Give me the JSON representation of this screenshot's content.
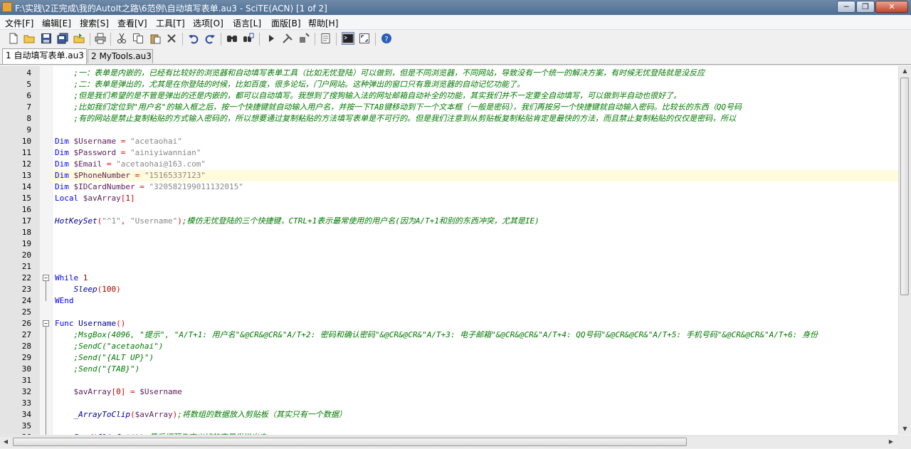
{
  "window": {
    "title": "F:\\实践\\2正完成\\我的AutoIt之路\\6范例\\自动填写表单.au3 - SciTE(ACN) [1 of 2]",
    "minimize": "─",
    "maximize": "❐",
    "close": "✕"
  },
  "menu": [
    "文件[F]",
    "编辑[E]",
    "搜索[S]",
    "查看[V]",
    "工具[T]",
    "选项[O]",
    "语言[L]",
    "面版[B]",
    "帮助[H]"
  ],
  "tabs": [
    "1 自动填写表单.au3",
    "2 MyTools.au3"
  ],
  "toolbar_icons": [
    "new-file-icon",
    "open-folder-icon",
    "save-icon",
    "save-all-icon",
    "open-recent-icon",
    "print-icon",
    "cut-icon",
    "copy-icon",
    "paste-icon",
    "delete-icon",
    "undo-icon",
    "redo-icon",
    "find-icon",
    "replace-icon",
    "run-icon",
    "build-icon",
    "compile-icon",
    "properties-icon",
    "console-icon",
    "fullscreen-icon",
    "help-icon"
  ],
  "colors": {
    "current_line": "#fffbdc",
    "comment": "#007a00",
    "keyword": "#0000ff",
    "string": "#888888"
  },
  "lines": [
    {
      "n": "4",
      "t": [
        {
          "c": "cm",
          "s": "    ;一：表单是内嵌的，已经有比较好的浏览器和自动填写表单工具（比如无忧登陆）可以做到，但是不同浏览器，不同网站，导致没有一个统一的解决方案，有时候无忧登陆就是没反应"
        }
      ]
    },
    {
      "n": "5",
      "t": [
        {
          "c": "cm",
          "s": "    ;二：表单是弹出的，尤其是在你登陆的时候，比如百度，很多论坛，门户网站。这种弹出的窗口只有靠浏览器的自动记忆功能了。"
        }
      ]
    },
    {
      "n": "6",
      "t": [
        {
          "c": "cm",
          "s": "    ;但是我们希望的是不管是弹出的还是内嵌的，都可以自动填写。我想到了搜狗输入法的网址邮箱自动补全的功能，其实我们并不一定要全自动填写，可以做到半自动也很好了。"
        }
      ]
    },
    {
      "n": "7",
      "t": [
        {
          "c": "cm",
          "s": "    ;比如我们定位到\"用户名\"的输入框之后，按一个快捷键就自动输入用户名，并按一下TAB键移动到下一个文本框（一般是密码），我们再按另一个快捷键就自动输入密码。比较长的东西（QQ号码"
        }
      ]
    },
    {
      "n": "8",
      "t": [
        {
          "c": "cm",
          "s": "    ;有的网站是禁止复制粘贴的方式输入密码的，所以想要通过复制粘贴的方法填写表单是不可行的。但是我们注意到从剪贴板复制粘贴肯定是最快的方法，而且禁止复制粘贴的仅仅是密码，所以"
        }
      ]
    },
    {
      "n": "9",
      "t": []
    },
    {
      "n": "10",
      "t": [
        {
          "c": "kw",
          "s": "Dim "
        },
        {
          "c": "vr",
          "s": "$Username"
        },
        {
          "c": "op",
          "s": " = "
        },
        {
          "c": "st",
          "s": "\"acetaohai\""
        }
      ]
    },
    {
      "n": "11",
      "t": [
        {
          "c": "kw",
          "s": "Dim "
        },
        {
          "c": "vr",
          "s": "$Password"
        },
        {
          "c": "op",
          "s": " = "
        },
        {
          "c": "st",
          "s": "\"ainiyiwannian\""
        }
      ]
    },
    {
      "n": "12",
      "t": [
        {
          "c": "kw",
          "s": "Dim "
        },
        {
          "c": "vr",
          "s": "$Email"
        },
        {
          "c": "op",
          "s": " = "
        },
        {
          "c": "st",
          "s": "\"acetaohai@163.com\""
        }
      ]
    },
    {
      "n": "13",
      "t": [
        {
          "c": "kw",
          "s": "Dim "
        },
        {
          "c": "vr",
          "s": "$PhoneNumber"
        },
        {
          "c": "op",
          "s": " = "
        },
        {
          "c": "st",
          "s": "\"15165337123\""
        }
      ]
    },
    {
      "n": "14",
      "t": [
        {
          "c": "kw",
          "s": "Dim "
        },
        {
          "c": "vr",
          "s": "$IDCardNumber"
        },
        {
          "c": "op",
          "s": " = "
        },
        {
          "c": "st",
          "s": "\"320582199011132015\""
        }
      ]
    },
    {
      "n": "15",
      "t": [
        {
          "c": "kw",
          "s": "Local "
        },
        {
          "c": "vr",
          "s": "$avArray"
        },
        {
          "c": "op",
          "s": "["
        },
        {
          "c": "nm",
          "s": "1"
        },
        {
          "c": "op",
          "s": "]"
        }
      ]
    },
    {
      "n": "16",
      "t": []
    },
    {
      "n": "17",
      "t": [
        {
          "c": "fn",
          "s": "HotKeySet"
        },
        {
          "c": "op",
          "s": "("
        },
        {
          "c": "st",
          "s": "\"^1\""
        },
        {
          "c": "op",
          "s": ", "
        },
        {
          "c": "st",
          "s": "\"Username\""
        },
        {
          "c": "op",
          "s": ")"
        },
        {
          "c": "cm",
          "s": ";模仿无忧登陆的三个快捷键，CTRL+1表示最常使用的用户名(因为A/T+1和别的东西冲突，尤其是IE)"
        }
      ]
    },
    {
      "n": "18",
      "t": []
    },
    {
      "n": "19",
      "t": []
    },
    {
      "n": "20",
      "t": []
    },
    {
      "n": "21",
      "t": []
    },
    {
      "n": "22",
      "t": [
        {
          "c": "kw",
          "s": "While "
        },
        {
          "c": "nm",
          "s": "1"
        }
      ]
    },
    {
      "n": "23",
      "t": [
        {
          "c": "",
          "s": "    "
        },
        {
          "c": "fn",
          "s": "Sleep"
        },
        {
          "c": "op",
          "s": "("
        },
        {
          "c": "nm",
          "s": "100"
        },
        {
          "c": "op",
          "s": ")"
        }
      ]
    },
    {
      "n": "24",
      "t": [
        {
          "c": "kw",
          "s": "WEnd"
        }
      ]
    },
    {
      "n": "25",
      "t": []
    },
    {
      "n": "26",
      "t": [
        {
          "c": "kw",
          "s": "Func "
        },
        {
          "c": "fnu",
          "s": "Username"
        },
        {
          "c": "op",
          "s": "()"
        }
      ]
    },
    {
      "n": "27",
      "t": [
        {
          "c": "cm",
          "s": "    ;MsgBox(4096, \"提示\", \"A/T+1: 用户名\"&@CR&@CR&\"A/T+2: 密码和确认密码\"&@CR&@CR&\"A/T+3: 电子邮箱\"&@CR&@CR&\"A/T+4: QQ号码\"&@CR&@CR&\"A/T+5: 手机号码\"&@CR&@CR&\"A/T+6: 身份"
        }
      ]
    },
    {
      "n": "28",
      "t": [
        {
          "c": "cm",
          "s": "    ;SendC(\"acetaohai\")"
        }
      ]
    },
    {
      "n": "29",
      "t": [
        {
          "c": "cm",
          "s": "    ;Send(\"{ALT UP}\")"
        }
      ]
    },
    {
      "n": "30",
      "t": [
        {
          "c": "cm",
          "s": "    ;Send(\"{TAB}\")"
        }
      ]
    },
    {
      "n": "31",
      "t": []
    },
    {
      "n": "32",
      "t": [
        {
          "c": "",
          "s": "    "
        },
        {
          "c": "vr",
          "s": "$avArray"
        },
        {
          "c": "op",
          "s": "["
        },
        {
          "c": "nm",
          "s": "0"
        },
        {
          "c": "op",
          "s": "] = "
        },
        {
          "c": "vr",
          "s": "$Username"
        }
      ]
    },
    {
      "n": "33",
      "t": []
    },
    {
      "n": "34",
      "t": [
        {
          "c": "",
          "s": "    "
        },
        {
          "c": "fn",
          "s": "_ArrayToClip"
        },
        {
          "c": "op",
          "s": "("
        },
        {
          "c": "vr",
          "s": "$avArray"
        },
        {
          "c": "op",
          "s": ")"
        },
        {
          "c": "cm",
          "s": ";将数组的数据放入剪贴板（其实只有一个数据）"
        }
      ]
    },
    {
      "n": "35",
      "t": []
    },
    {
      "n": "36",
      "t": [
        {
          "c": "",
          "s": "    "
        },
        {
          "c": "fn",
          "s": "Send"
        },
        {
          "c": "op",
          "s": "("
        },
        {
          "c": "fn",
          "s": "ClipGet"
        },
        {
          "c": "op",
          "s": "())"
        },
        {
          "c": "cm",
          "s": ";最后把预先定义好的变量发送出去"
        }
      ]
    }
  ],
  "current_line": "13",
  "fold_lines": [
    "22",
    "26"
  ]
}
